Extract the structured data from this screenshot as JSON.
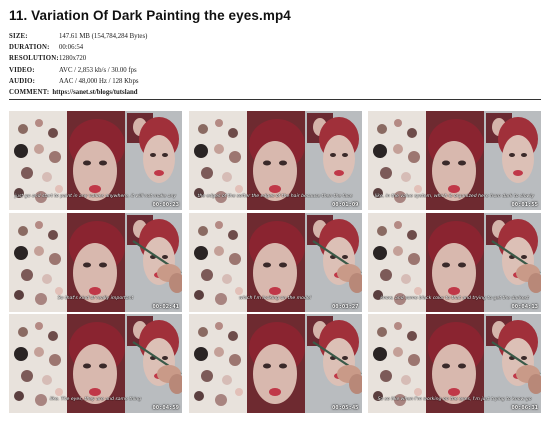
{
  "title": "11. Variation Of Dark Painting the eyes.mp4",
  "meta": {
    "size_label": "SIZE:",
    "size": "147.61 MB (154,784,284 Bytes)",
    "duration_label": "DURATION:",
    "duration": "00:06:54",
    "resolution_label": "RESOLUTION:",
    "resolution": "1280x720",
    "video_label": "VIDEO:",
    "video": "AVC / 2,853 kb/s / 30.00 fps",
    "audio_label": "AUDIO:",
    "audio": "AAC / 48,000 Hz / 128 Kbps",
    "comment_label": "COMMENT:",
    "comment": "https://sanet.st/blogs/tutsland"
  },
  "thumbnails": [
    {
      "subtitle": "just go and start to paint in any values anywhere, it will not make any",
      "timestamp": "00:00:23",
      "brush": false
    },
    {
      "subtitle": "the edges of the softer the edges of the hair because then the face",
      "timestamp": "00:01:09",
      "brush": false
    },
    {
      "subtitle": "like, in the value system, which is organized here from dark to slowly",
      "timestamp": "00:01:55",
      "brush": false
    },
    {
      "subtitle": "So that's kind of really important",
      "timestamp": "00:02:41",
      "brush": true
    },
    {
      "subtitle": "which I'm looking on the model",
      "timestamp": "00:03:27",
      "brush": true
    },
    {
      "subtitle": "know, and some black color to that and trying to get the darkest",
      "timestamp": "00:04:13",
      "brush": true
    },
    {
      "subtitle": "like. The eyes, they are and same thing",
      "timestamp": "00:04:59",
      "brush": true
    },
    {
      "subtitle": "",
      "timestamp": "00:05:45",
      "brush": true
    },
    {
      "subtitle": "So so like when I'm working on the eyes, I'm just trying to know go",
      "timestamp": "00:06:31",
      "brush": true
    }
  ],
  "colors": {
    "hair": "#9a2a30",
    "skin": "#d8b8ae",
    "wall": "#b9bcbf",
    "palette": "#e8e2dc",
    "lips": "#c03848"
  }
}
